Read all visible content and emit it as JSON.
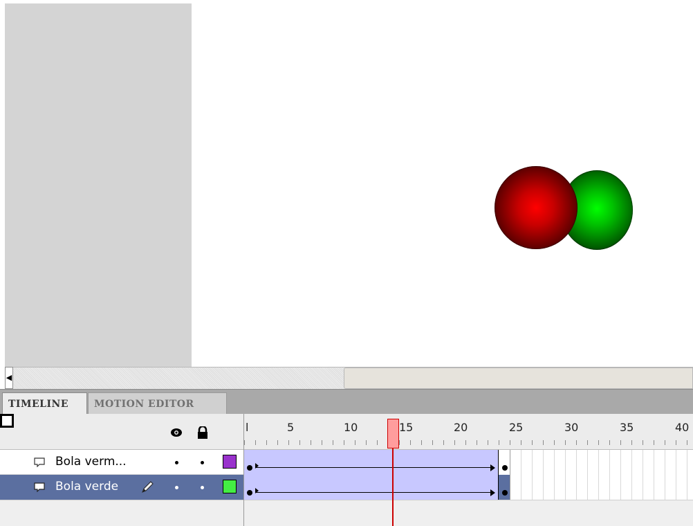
{
  "stage": {
    "objects": [
      {
        "name": "Bola verde",
        "color": "#00ff00"
      },
      {
        "name": "Bola vermelha",
        "color": "#ff0000"
      }
    ]
  },
  "scrollbar": {
    "left_arrow": "◀"
  },
  "tabs": [
    {
      "label": "TIMELINE",
      "active": true
    },
    {
      "label": "MOTION EDITOR",
      "active": false
    }
  ],
  "header_icons": [
    "eye-icon",
    "lock-icon",
    "outline-icon"
  ],
  "ruler": {
    "labels": [
      "l",
      "5",
      "10",
      "15",
      "20",
      "25",
      "30",
      "35",
      "40"
    ],
    "current_frame": 14
  },
  "layers": [
    {
      "name": "Bola verm...",
      "selected": false,
      "color": "#9932cc",
      "icon": "layer-icon"
    },
    {
      "name": "Bola verde",
      "selected": true,
      "color": "#44ee44",
      "icon": "layer-icon",
      "edit_icon": "pencil-icon"
    }
  ],
  "colors": {
    "selection": "#5b6fa0",
    "tween": "#c8c8ff",
    "playhead": "#cc0000"
  }
}
